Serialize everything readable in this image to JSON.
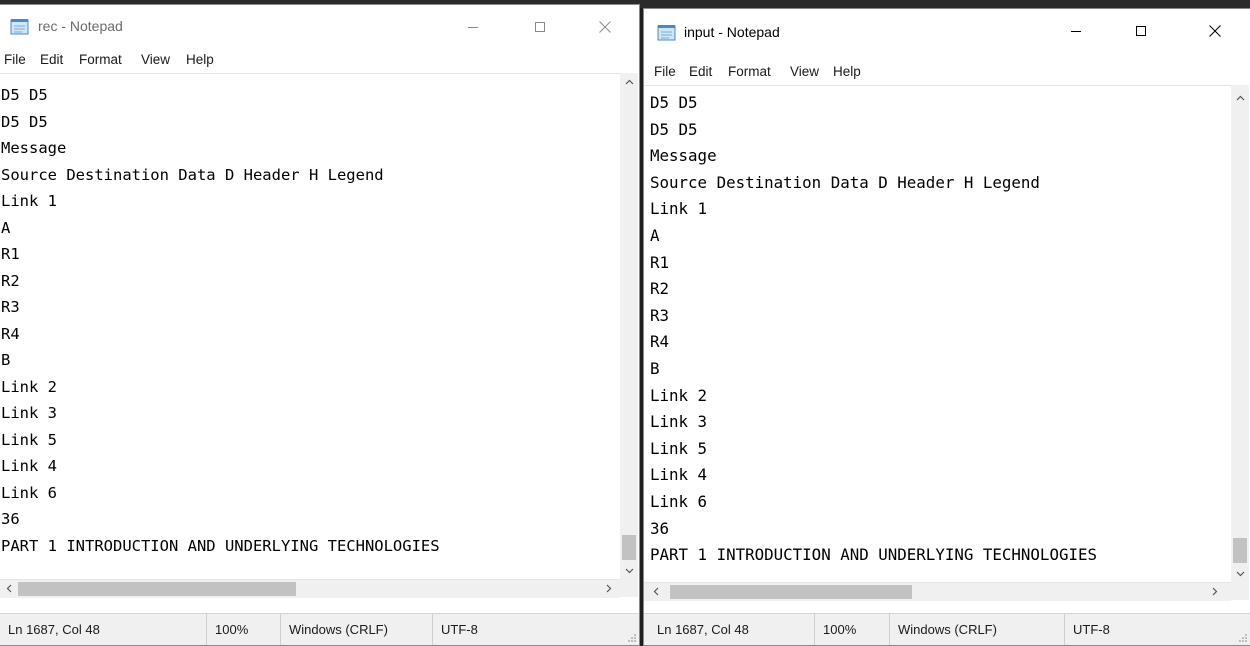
{
  "windows": {
    "left": {
      "title": "rec - Notepad",
      "menu": [
        "File",
        "Edit",
        "Format",
        "View",
        "Help"
      ],
      "lines": [
        "D5 D5",
        "D5 D5",
        "Message",
        "Source Destination Data D Header H Legend",
        "Link 1",
        "A",
        "R1",
        "R2",
        "R3",
        "R4",
        "B",
        "Link 2",
        "Link 3",
        "Link 5",
        "Link 4",
        "Link 6",
        "36",
        "PART 1 INTRODUCTION AND UNDERLYING TECHNOLOGIES"
      ],
      "status": {
        "position": "Ln 1687, Col 48",
        "zoom": "100%",
        "line_ending": "Windows (CRLF)",
        "encoding": "UTF-8"
      }
    },
    "right": {
      "title": "input - Notepad",
      "menu": [
        "File",
        "Edit",
        "Format",
        "View",
        "Help"
      ],
      "lines": [
        "D5 D5",
        "D5 D5",
        "Message",
        "Source Destination Data D Header H Legend",
        "Link 1",
        "A",
        "R1",
        "R2",
        "R3",
        "R4",
        "B",
        "Link 2",
        "Link 3",
        "Link 5",
        "Link 4",
        "Link 6",
        "36",
        "PART 1 INTRODUCTION AND UNDERLYING TECHNOLOGIES"
      ],
      "status": {
        "position": "Ln 1687, Col 48",
        "zoom": "100%",
        "line_ending": "Windows (CRLF)",
        "encoding": "UTF-8"
      }
    }
  },
  "icons": {
    "app": "notepad-icon",
    "minimize": "minimize-icon",
    "maximize": "maximize-icon",
    "close": "close-icon",
    "scroll_up": "chevron-up-icon",
    "scroll_down": "chevron-down-icon",
    "scroll_left": "chevron-left-icon",
    "scroll_right": "chevron-right-icon",
    "resize": "resize-grip-icon"
  },
  "colors": {
    "window_bg": "#ffffff",
    "status_bg": "#f0f0f0",
    "scroll_thumb": "#c2c2c2",
    "inactive_title": "#6b6b6b"
  }
}
